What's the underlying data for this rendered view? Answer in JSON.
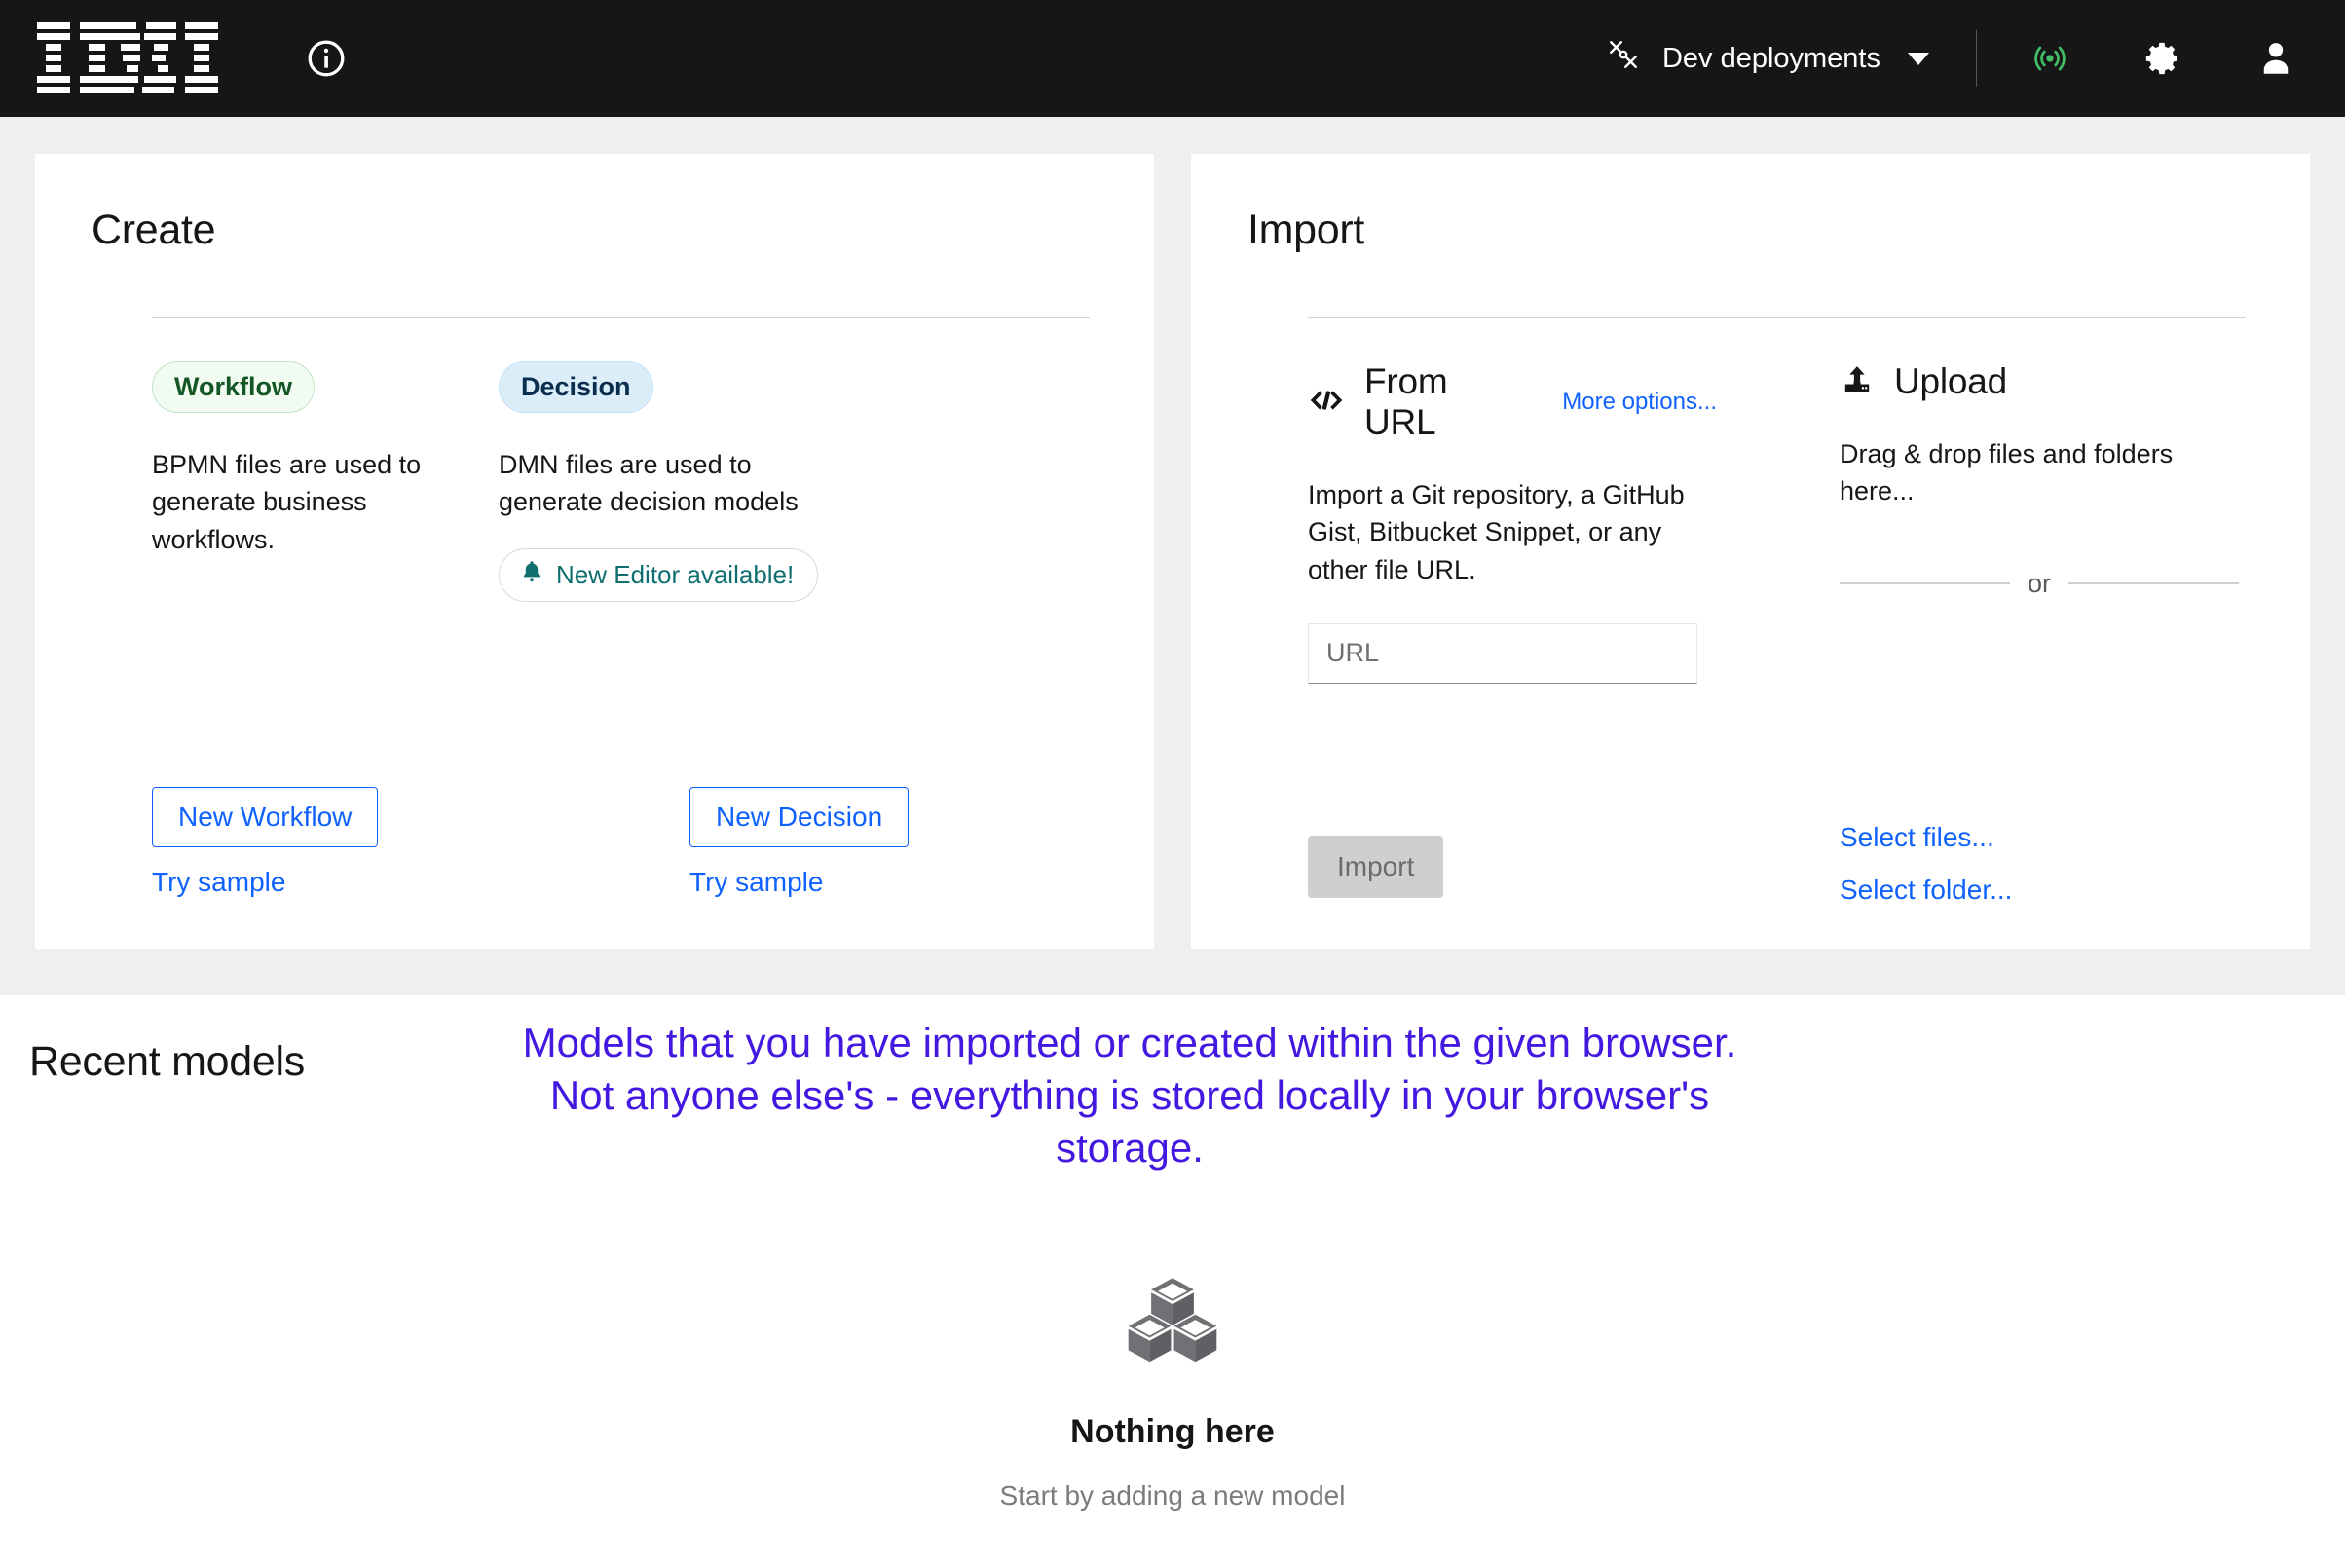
{
  "header": {
    "logo_alt": "IBM",
    "info_icon": "info-circle-icon",
    "deployments_label": "Dev deployments",
    "deployments_icon": "satellite-icon",
    "caret_icon": "chevron-down-icon",
    "connection_icon": "broadcast-connected-icon",
    "connection_color": "#42be65",
    "settings_icon": "gear-icon",
    "account_icon": "user-avatar-icon"
  },
  "create": {
    "title": "Create",
    "columns": [
      {
        "tag": "Workflow",
        "tag_color": "#155724",
        "tag_bg": "#f1fbf2",
        "description": "BPMN files are used to generate business workflows.",
        "button_label": "New Workflow",
        "sample_label": "Try sample",
        "badge": null
      },
      {
        "tag": "Decision",
        "tag_color": "#0b2e4f",
        "tag_bg": "#dcedfa",
        "description": "DMN files are used to generate decision models",
        "button_label": "New Decision",
        "sample_label": "Try sample",
        "badge": {
          "icon": "bell-icon",
          "label": "New Editor available!",
          "color": "#0f6e6e"
        }
      }
    ]
  },
  "import": {
    "title": "Import",
    "from_url": {
      "icon": "code-brackets-icon",
      "title": "From URL",
      "more_options_label": "More options...",
      "description": "Import a Git repository, a GitHub Gist, Bitbucket Snippet, or any other file URL.",
      "url_placeholder": "URL",
      "url_value": "",
      "import_button_label": "Import",
      "import_button_disabled": true
    },
    "upload": {
      "icon": "upload-icon",
      "title": "Upload",
      "description": "Drag & drop files and folders here...",
      "or_label": "or",
      "select_files_label": "Select files...",
      "select_folder_label": "Select folder..."
    }
  },
  "recent": {
    "title": "Recent models",
    "annotation": "Models that you have imported or created within the given browser. Not anyone else's - everything is stored locally in your browser's storage.",
    "annotation_color": "#4318e0",
    "empty_icon": "cubes-icon",
    "empty_title": "Nothing here",
    "empty_subtitle": "Start by adding a new model"
  },
  "theme": {
    "header_bg": "#161616",
    "page_bg": "#efefef",
    "card_bg": "#ffffff",
    "link_blue": "#0f62fe"
  }
}
